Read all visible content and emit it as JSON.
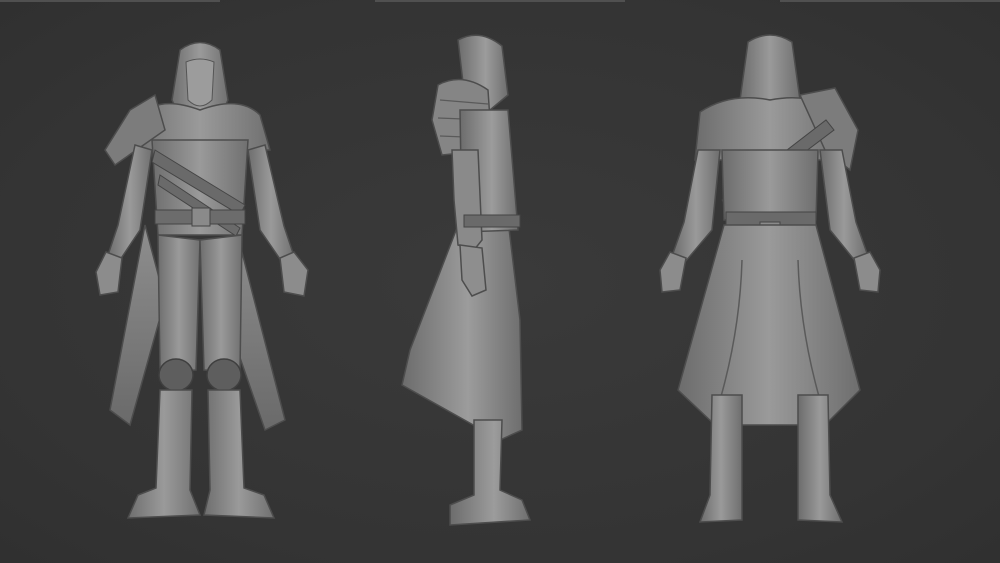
{
  "scene": {
    "background_color": "#363636",
    "material_color": "#8a8a8a",
    "shadow_color": "#4a4a4a",
    "highlight_color": "#b4b4b4",
    "views": [
      {
        "name": "front-view",
        "subject": "hooded-assassin-character"
      },
      {
        "name": "side-view",
        "subject": "hooded-assassin-character"
      },
      {
        "name": "back-view",
        "subject": "hooded-assassin-character"
      }
    ]
  }
}
